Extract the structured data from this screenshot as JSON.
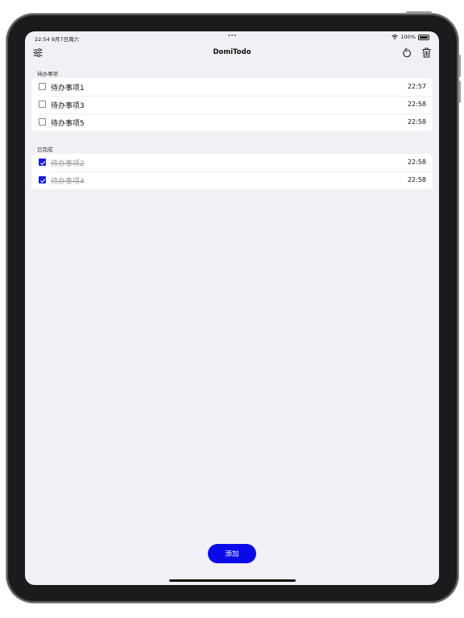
{
  "status_bar": {
    "time": "22:54  9月7日周六",
    "multitask_dots": "•••",
    "battery": "100%"
  },
  "nav": {
    "title": "DomiTodo",
    "left_icon": "sliders-icon",
    "right_icons": [
      "undo-icon",
      "trash-icon"
    ]
  },
  "pending": {
    "header": "待办事项",
    "items": [
      {
        "label": "待办事项1",
        "time": "22:57",
        "checked": false
      },
      {
        "label": "待办事项3",
        "time": "22:58",
        "checked": false
      },
      {
        "label": "待办事项5",
        "time": "22:58",
        "checked": false
      }
    ]
  },
  "completed": {
    "header": "已完成",
    "items": [
      {
        "label": "待办事项2",
        "time": "22:58",
        "checked": true
      },
      {
        "label": "待办事项4",
        "time": "22:58",
        "checked": true
      }
    ]
  },
  "add_button": {
    "label": "添加"
  },
  "colors": {
    "accent": "#0a0ae8",
    "background": "#f1f0f5",
    "card": "#ffffff"
  }
}
